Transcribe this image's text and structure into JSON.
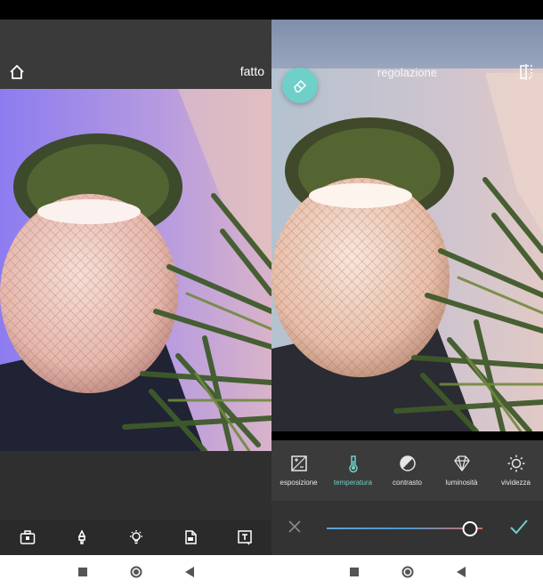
{
  "left_panel": {
    "done_label": "fatto",
    "toolbar": [
      "toolbox-icon",
      "brush-icon",
      "bulb-icon",
      "document-icon",
      "text-icon"
    ]
  },
  "right_panel": {
    "title": "regolazione",
    "tools": [
      {
        "label": "esposizione",
        "icon": "exposure-icon",
        "active": false
      },
      {
        "label": "temperatura",
        "icon": "thermometer-icon",
        "active": true
      },
      {
        "label": "contrasto",
        "icon": "contrast-icon",
        "active": false
      },
      {
        "label": "luminosità",
        "icon": "diamond-icon",
        "active": false
      },
      {
        "label": "vividezza",
        "icon": "sun-icon",
        "active": false
      }
    ],
    "slider": {
      "value": 0.92
    }
  },
  "nav_buttons": [
    "square-icon",
    "circle-icon",
    "back-triangle-icon"
  ],
  "colors": {
    "accent": "#6fd0c9",
    "toolbar_bg": "#2a2a2a",
    "header_bg": "#3a3a3a",
    "track_start": "#5da3d6",
    "track_end": "#d86b5c"
  }
}
